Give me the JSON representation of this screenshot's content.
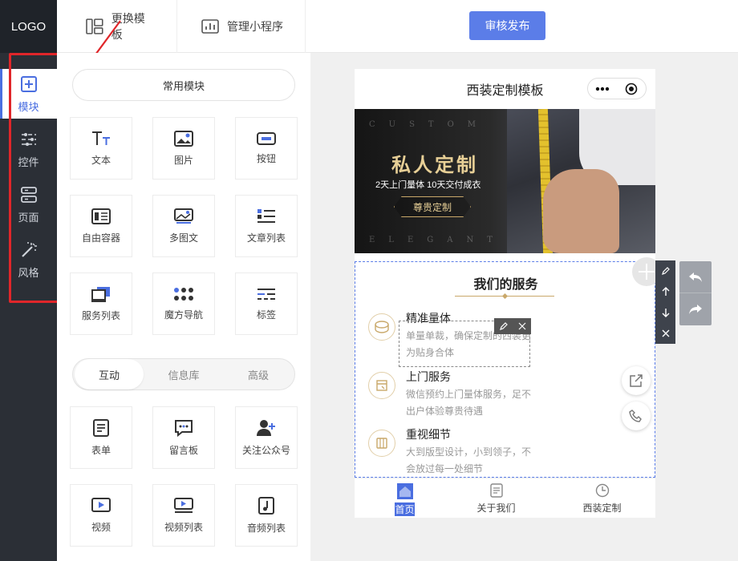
{
  "sidebar": {
    "logo": "LOGO",
    "items": [
      {
        "label": "模块",
        "icon": "plus-square-icon"
      },
      {
        "label": "控件",
        "icon": "sliders-icon"
      },
      {
        "label": "页面",
        "icon": "pages-icon"
      },
      {
        "label": "风格",
        "icon": "magic-wand-icon"
      }
    ],
    "active_index": 0,
    "highlight_color": "#e0262a"
  },
  "topbar": {
    "tabs": [
      {
        "label": "更换模板",
        "icon": "template-icon"
      },
      {
        "label": "管理小程序",
        "icon": "bar-chart-icon"
      }
    ],
    "publish_label": "审核发布"
  },
  "panel": {
    "common_label": "常用模块",
    "common_tiles": [
      {
        "label": "文本",
        "icon": "text-icon"
      },
      {
        "label": "图片",
        "icon": "image-icon"
      },
      {
        "label": "按钮",
        "icon": "button-icon"
      },
      {
        "label": "自由容器",
        "icon": "container-icon"
      },
      {
        "label": "多图文",
        "icon": "multi-image-icon"
      },
      {
        "label": "文章列表",
        "icon": "article-list-icon"
      },
      {
        "label": "服务列表",
        "icon": "service-list-icon"
      },
      {
        "label": "魔方导航",
        "icon": "grid-nav-icon"
      },
      {
        "label": "标签",
        "icon": "tags-icon"
      }
    ],
    "segments": [
      "互动",
      "信息库",
      "高级"
    ],
    "active_segment": 0,
    "interact_tiles": [
      {
        "label": "表单",
        "icon": "form-icon"
      },
      {
        "label": "留言板",
        "icon": "message-board-icon"
      },
      {
        "label": "关注公众号",
        "icon": "follow-account-icon"
      },
      {
        "label": "视频",
        "icon": "video-icon"
      },
      {
        "label": "视频列表",
        "icon": "video-list-icon"
      },
      {
        "label": "音频列表",
        "icon": "audio-list-icon"
      }
    ]
  },
  "preview": {
    "page_title": "西装定制模板",
    "banner": {
      "ghost_top": "CUSTOM",
      "ghost_bottom": "ELEGANT",
      "title": "私人定制",
      "subtitle": "2天上门量体  10天交付成衣",
      "button": "尊贵定制"
    },
    "services": {
      "title": "我们的服务",
      "items": [
        {
          "name": "精准量体",
          "desc": "单量单裁，确保定制的西装更为贴身合体"
        },
        {
          "name": "上门服务",
          "desc": "微信预约上门量体服务，足不出户体验尊贵待遇"
        },
        {
          "name": "重视细节",
          "desc": "大到版型设计，小到领子，不会放过每一处细节"
        }
      ]
    },
    "tabbar": [
      {
        "label": "首页",
        "icon": "home-icon"
      },
      {
        "label": "关于我们",
        "icon": "document-icon"
      },
      {
        "label": "西装定制",
        "icon": "clock-icon"
      }
    ],
    "active_tab": 0
  }
}
